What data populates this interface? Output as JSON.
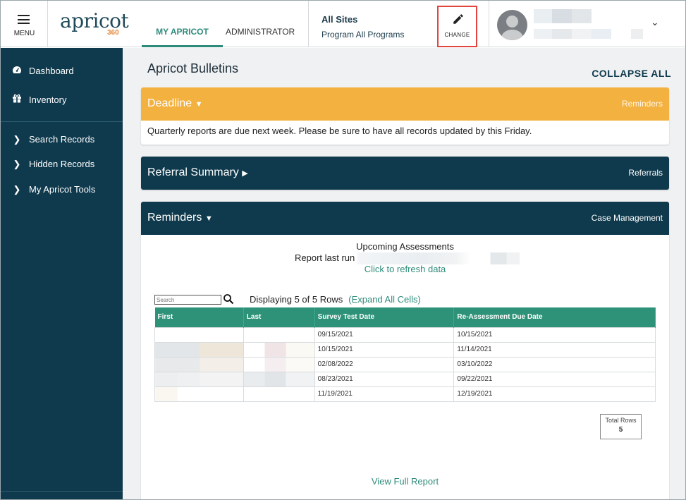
{
  "header": {
    "menu_label": "MENU",
    "logo_text": "apricot",
    "logo_sub": "360",
    "tabs": [
      {
        "label": "MY APRICOT"
      },
      {
        "label": "ADMINISTRATOR"
      }
    ],
    "site_title": "All Sites",
    "program_label": "Program All Programs",
    "change_label": "CHANGE",
    "accent_color": "#2e8b7a",
    "highlight_color": "#e0453e"
  },
  "sidebar": {
    "items": [
      {
        "label": "Dashboard",
        "icon": "dashboard-icon"
      },
      {
        "label": "Inventory",
        "icon": "gift-box-icon"
      },
      {
        "label": "Search Records",
        "icon": "chevron-right-icon"
      },
      {
        "label": "Hidden Records",
        "icon": "chevron-right-icon"
      },
      {
        "label": "My Apricot Tools",
        "icon": "chevron-right-icon"
      }
    ]
  },
  "main": {
    "title": "Apricot Bulletins",
    "collapse_all": "COLLAPSE ALL",
    "bulletins": [
      {
        "title": "Deadline",
        "right": "Reminders",
        "message": "Quarterly reports are due next week. Please be sure to have all records updated by this Friday.",
        "color": "#f3b140"
      },
      {
        "title": "Referral Summary",
        "right": "Referrals",
        "color": "#0f3a4d"
      },
      {
        "title": "Reminders",
        "right": "Case Management",
        "color": "#0f3a4d"
      }
    ],
    "report": {
      "name": "Upcoming Assessments",
      "last_run_label": "Report last run",
      "refresh_label": "Click to refresh data",
      "search_placeholder": "Search",
      "displaying": "Displaying 5 of 5 Rows",
      "expand_label": "(Expand All Cells)",
      "columns": [
        "First",
        "Last",
        "Survey Test Date",
        "Re-Assessment Due Date"
      ],
      "rows": [
        {
          "survey": "09/15/2021",
          "due": "10/15/2021"
        },
        {
          "survey": "10/15/2021",
          "due": "11/14/2021"
        },
        {
          "survey": "02/08/2022",
          "due": "03/10/2022"
        },
        {
          "survey": "08/23/2021",
          "due": "09/22/2021"
        },
        {
          "survey": "11/19/2021",
          "due": "12/19/2021"
        }
      ],
      "total_rows_label": "Total Rows",
      "total_rows_value": "5",
      "view_full_label": "View Full Report"
    }
  }
}
